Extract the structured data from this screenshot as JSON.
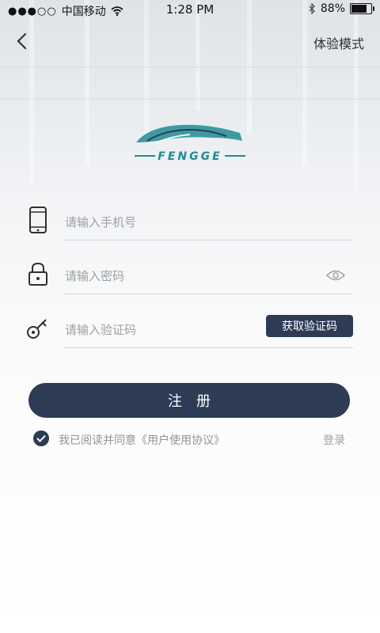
{
  "status_bar": {
    "signal": "●●●○○",
    "carrier": "中国移动",
    "time": "1:28 PM",
    "battery_percent": "88%",
    "battery_level": 0.88
  },
  "nav": {
    "trial_label": "体验模式"
  },
  "logo": {
    "text": "FENGGE",
    "color": "#1f8b95"
  },
  "form": {
    "phone_placeholder": "请输入手机号",
    "password_placeholder": "请输入密码",
    "code_placeholder": "请输入验证码",
    "get_code_label": "获取验证码",
    "register_label": "注册"
  },
  "agreement": {
    "text": "我已阅读并同意《用户使用协议》",
    "login_label": "登录"
  },
  "colors": {
    "primary": "#2d3b54"
  }
}
